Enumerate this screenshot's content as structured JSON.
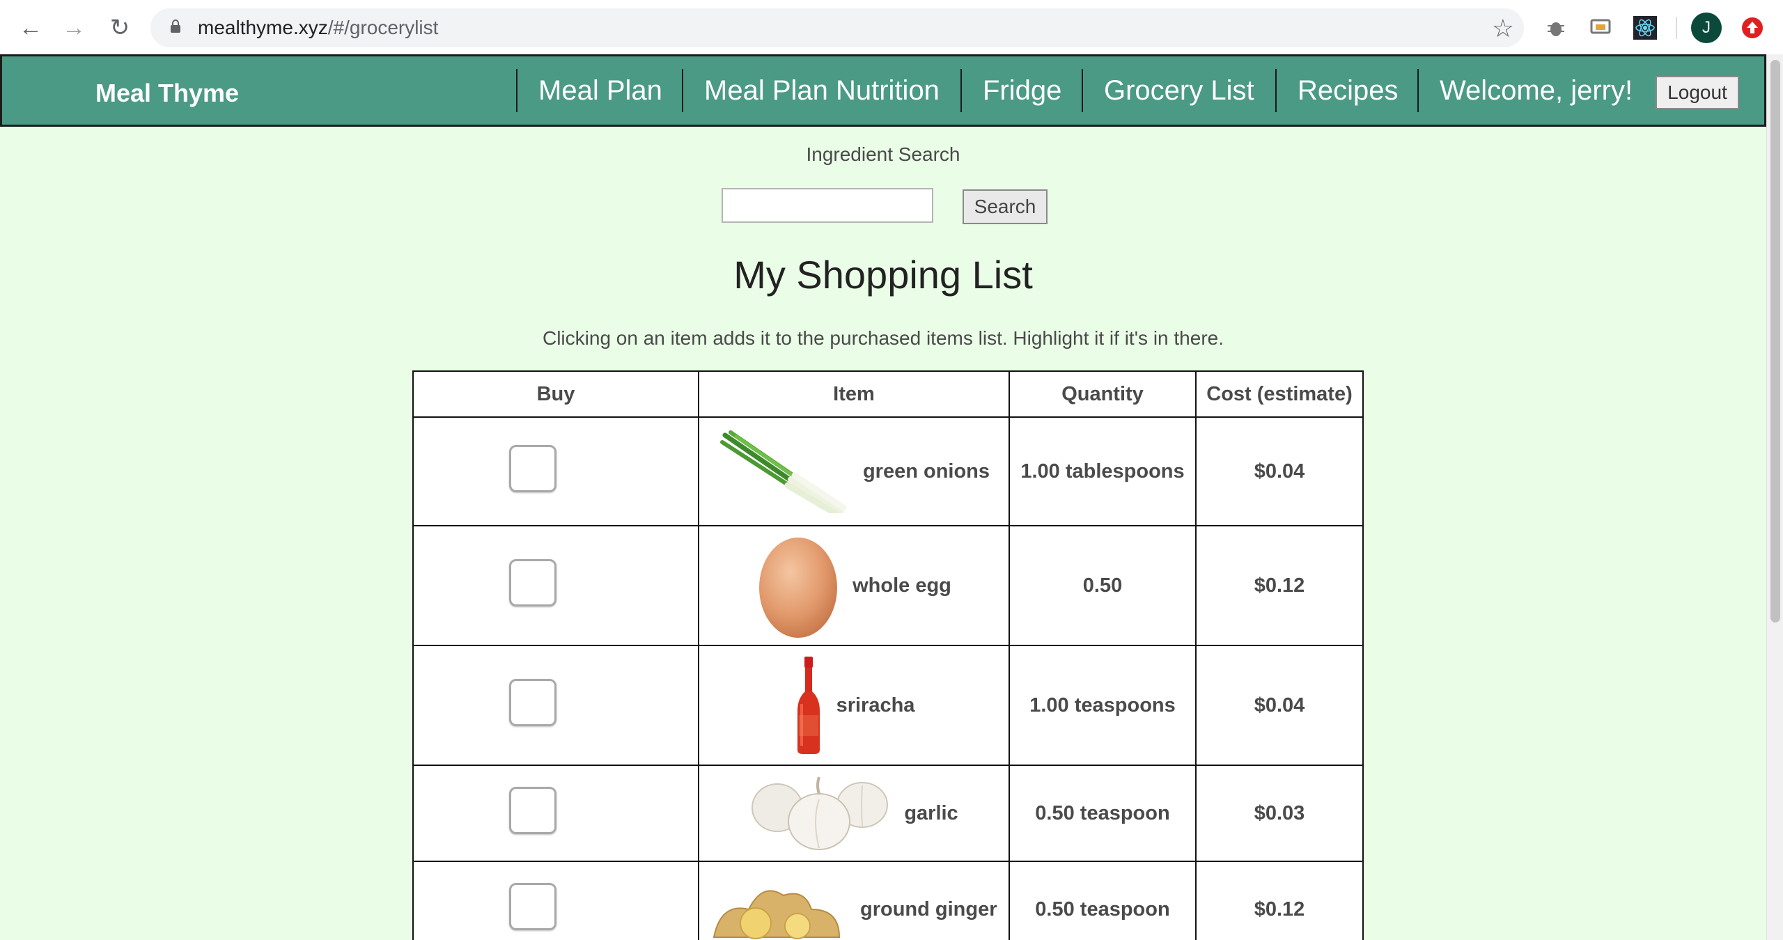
{
  "browser": {
    "url_host": "mealthyme.xyz",
    "url_path": "/#/grocerylist",
    "avatar_letter": "J"
  },
  "nav": {
    "brand": "Meal Thyme",
    "items": [
      {
        "label": "Meal Plan"
      },
      {
        "label": "Meal Plan Nutrition"
      },
      {
        "label": "Fridge"
      },
      {
        "label": "Grocery List"
      },
      {
        "label": "Recipes"
      },
      {
        "label": "Welcome, jerry!"
      }
    ],
    "logout_label": "Logout"
  },
  "search": {
    "label": "Ingredient Search",
    "value": "",
    "button_label": "Search"
  },
  "page": {
    "title": "My Shopping List",
    "instructions": "Clicking on an item adds it to the purchased items list. Highlight it if it's in there."
  },
  "table": {
    "headers": [
      "Buy",
      "Item",
      "Quantity",
      "Cost (estimate)"
    ],
    "rows": [
      {
        "item": "green onions",
        "image": "green-onions-image",
        "quantity": "1.00 tablespoons",
        "cost": "$0.04",
        "checked": false
      },
      {
        "item": "whole egg",
        "image": "egg-image",
        "quantity": "0.50",
        "cost": "$0.12",
        "checked": false
      },
      {
        "item": "sriracha",
        "image": "sriracha-bottle-image",
        "quantity": "1.00 teaspoons",
        "cost": "$0.04",
        "checked": false
      },
      {
        "item": "garlic",
        "image": "garlic-image",
        "quantity": "0.50 teaspoon",
        "cost": "$0.03",
        "checked": false
      },
      {
        "item": "ground ginger",
        "image": "ginger-image",
        "quantity": "0.50 teaspoon",
        "cost": "$0.12",
        "checked": false
      }
    ]
  },
  "colors": {
    "navbar": "#4a9a85",
    "page_background": "#eafde7",
    "border": "#111111"
  }
}
